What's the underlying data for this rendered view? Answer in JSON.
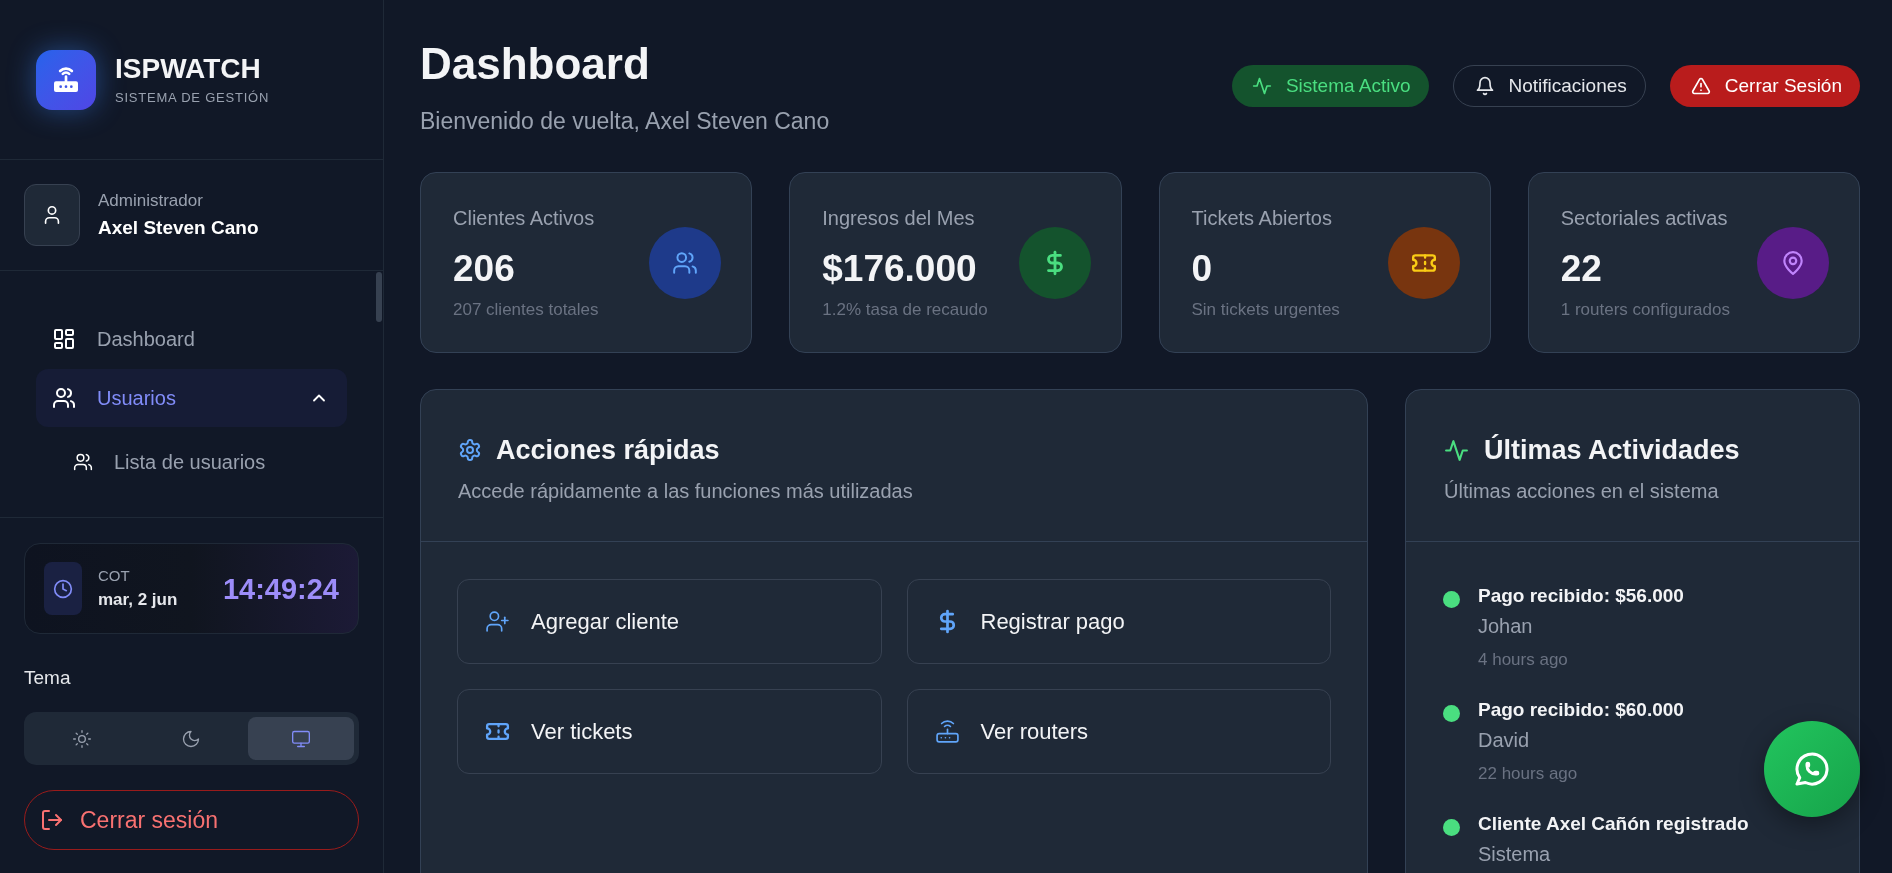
{
  "sidebar": {
    "brand": {
      "name": "ISPWATCH",
      "tagline": "SISTEMA DE GESTIÓN"
    },
    "user": {
      "role": "Administrador",
      "name": "Axel Steven Cano"
    },
    "nav": [
      {
        "kind": "dashboard",
        "label": "Dashboard",
        "selected": false
      },
      {
        "kind": "users",
        "label": "Usuarios",
        "selected": true,
        "expanded": true,
        "children": [
          {
            "kind": "users",
            "label": "Lista de usuarios",
            "selected": false
          }
        ]
      }
    ],
    "clock": {
      "zone": "COT",
      "date": "mar, 2 jun",
      "time": "14:49:24"
    },
    "theme": {
      "label": "Tema",
      "options": [
        {
          "kind": "light",
          "selected": false
        },
        {
          "kind": "dark",
          "selected": false
        },
        {
          "kind": "system",
          "selected": true
        }
      ]
    },
    "logout": {
      "label": "Cerrar sesión"
    }
  },
  "header": {
    "title": "Dashboard",
    "subtitle": "Bienvenido de vuelta, Axel Steven Cano",
    "actions": [
      {
        "kind": "status",
        "label": "Sistema Activo"
      },
      {
        "kind": "outline",
        "label": "Notificaciones"
      },
      {
        "kind": "danger",
        "label": "Cerrar Sesión"
      }
    ]
  },
  "stats": [
    {
      "kind": "clients",
      "title": "Clientes Activos",
      "value": "206",
      "note": "207 clientes totales"
    },
    {
      "kind": "revenue",
      "title": "Ingresos del Mes",
      "value": "$176.000",
      "note": "1.2% tasa de recaudo"
    },
    {
      "kind": "tickets",
      "title": "Tickets Abiertos",
      "value": "0",
      "note": "Sin tickets urgentes"
    },
    {
      "kind": "sectors",
      "title": "Sectoriales activas",
      "value": "22",
      "note": "1 routers configurados"
    }
  ],
  "quick_actions": {
    "title": "Acciones rápidas",
    "subtitle": "Accede rápidamente a las funciones más utilizadas",
    "buttons": [
      {
        "kind": "client",
        "label": "Agregar cliente"
      },
      {
        "kind": "payment",
        "label": "Registrar pago"
      },
      {
        "kind": "tickets",
        "label": "Ver tickets"
      },
      {
        "kind": "routers",
        "label": "Ver routers"
      }
    ]
  },
  "activities": {
    "title": "Últimas Actividades",
    "subtitle": "Últimas acciones en el sistema",
    "items": [
      {
        "title": "Pago recibido: $56.000",
        "author": "Johan",
        "time": "4 hours ago"
      },
      {
        "title": "Pago recibido: $60.000",
        "author": "David",
        "time": "22 hours ago"
      },
      {
        "title": "Cliente Axel Cañón registrado",
        "author": "Sistema"
      }
    ]
  }
}
